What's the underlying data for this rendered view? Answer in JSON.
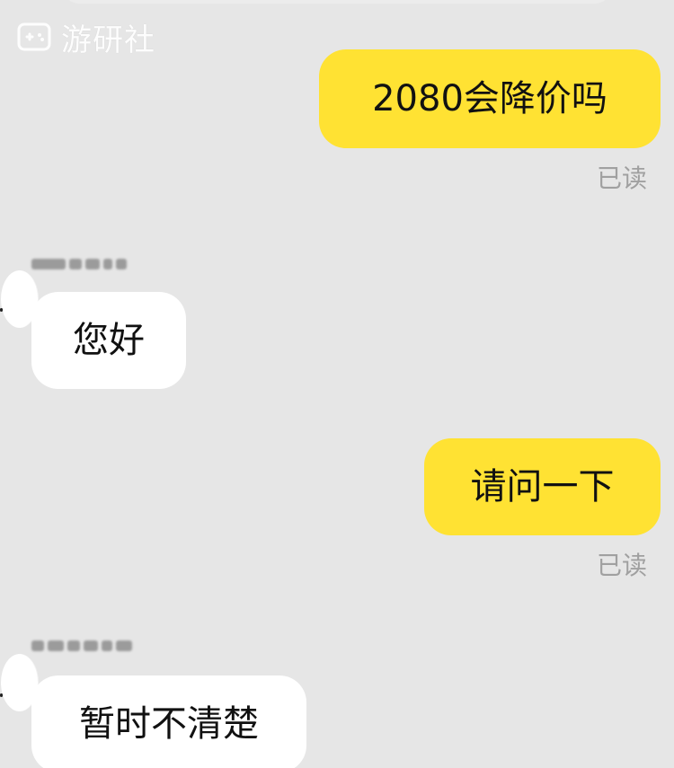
{
  "watermark": {
    "text": "游研社",
    "icon": "gamepad-icon"
  },
  "messages": {
    "m1": {
      "text": "2080会降价吗"
    },
    "read1": {
      "text": "已读"
    },
    "m2": {
      "text": "您好"
    },
    "m3": {
      "text": "请问一下"
    },
    "read2": {
      "text": "已读"
    },
    "m4": {
      "text": "暂时不清楚"
    }
  },
  "colors": {
    "background": "#e6e6e6",
    "outgoing_bubble": "#ffe233",
    "incoming_bubble": "#ffffff",
    "read_receipt": "#a0a0a0",
    "text": "#111111"
  }
}
